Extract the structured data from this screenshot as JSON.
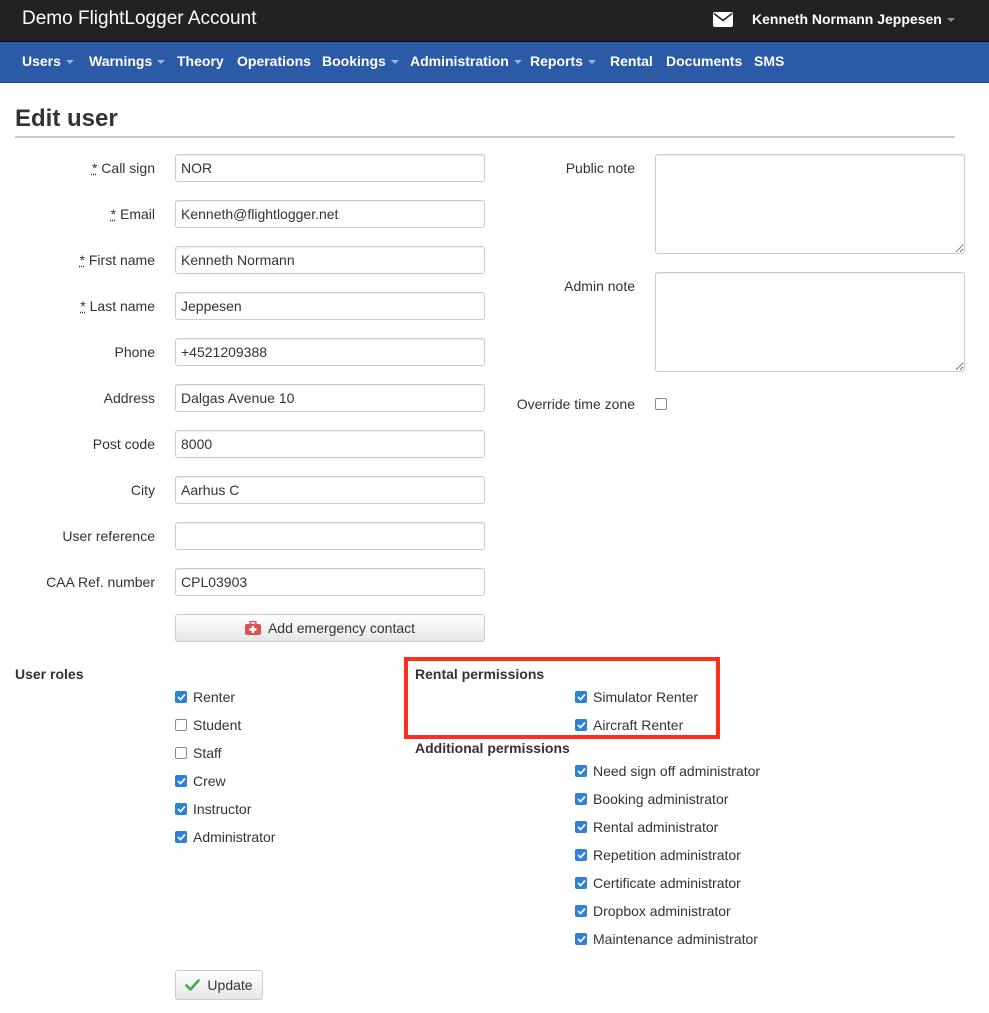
{
  "app": {
    "title": "Demo FlightLogger Account",
    "user_name": "Kenneth Normann Jeppesen"
  },
  "nav": {
    "items": [
      {
        "label": "Users",
        "dropdown": true
      },
      {
        "label": "Warnings",
        "dropdown": true
      },
      {
        "label": "Theory",
        "dropdown": false
      },
      {
        "label": "Operations",
        "dropdown": false
      },
      {
        "label": "Bookings",
        "dropdown": true
      },
      {
        "label": "Administration",
        "dropdown": true
      },
      {
        "label": "Reports",
        "dropdown": true
      },
      {
        "label": "Rental",
        "dropdown": false
      },
      {
        "label": "Documents",
        "dropdown": false
      },
      {
        "label": "SMS",
        "dropdown": false
      }
    ]
  },
  "page": {
    "heading": "Edit user"
  },
  "required_marker": "*",
  "fields": {
    "call_sign": {
      "label": "Call sign",
      "value": "NOR",
      "required": true
    },
    "email": {
      "label": "Email",
      "value": "Kenneth@flightlogger.net",
      "required": true
    },
    "first_name": {
      "label": "First name",
      "value": "Kenneth Normann",
      "required": true
    },
    "last_name": {
      "label": "Last name",
      "value": "Jeppesen",
      "required": true
    },
    "phone": {
      "label": "Phone",
      "value": "+4521209388"
    },
    "address": {
      "label": "Address",
      "value": "Dalgas Avenue 10"
    },
    "post_code": {
      "label": "Post code",
      "value": "8000"
    },
    "city": {
      "label": "City",
      "value": "Aarhus C"
    },
    "user_reference": {
      "label": "User reference",
      "value": ""
    },
    "caa_ref": {
      "label": "CAA Ref. number",
      "value": "CPL03903"
    },
    "public_note": {
      "label": "Public note",
      "value": ""
    },
    "admin_note": {
      "label": "Admin note",
      "value": ""
    },
    "override_tz": {
      "label": "Override time zone",
      "checked": false
    }
  },
  "buttons": {
    "add_emergency": "Add emergency contact",
    "update": "Update"
  },
  "user_roles": {
    "title": "User roles",
    "items": [
      {
        "label": "Renter",
        "checked": true
      },
      {
        "label": "Student",
        "checked": false
      },
      {
        "label": "Staff",
        "checked": false
      },
      {
        "label": "Crew",
        "checked": true
      },
      {
        "label": "Instructor",
        "checked": true
      },
      {
        "label": "Administrator",
        "checked": true
      }
    ]
  },
  "rental_permissions": {
    "title": "Rental permissions",
    "items": [
      {
        "label": "Simulator Renter",
        "checked": true
      },
      {
        "label": "Aircraft Renter",
        "checked": true
      }
    ]
  },
  "additional_permissions": {
    "title": "Additional permissions",
    "items": [
      {
        "label": "Need sign off administrator",
        "checked": true
      },
      {
        "label": "Booking administrator",
        "checked": true
      },
      {
        "label": "Rental administrator",
        "checked": true
      },
      {
        "label": "Repetition administrator",
        "checked": true
      },
      {
        "label": "Certificate administrator",
        "checked": true
      },
      {
        "label": "Dropbox administrator",
        "checked": true
      },
      {
        "label": "Maintenance administrator",
        "checked": true
      }
    ]
  },
  "colors": {
    "topbar": "#222222",
    "navbar": "#2b5aa6",
    "checkbox_accent": "#2f80d8",
    "highlight": "#ff2d1b",
    "emergency_icon": "#d9534f",
    "update_icon": "#3cb043"
  },
  "icons": {
    "mail": "envelope-icon",
    "emergency": "first-aid-kit-icon",
    "update": "checkmark-icon",
    "dropdown": "caret-down-icon"
  }
}
